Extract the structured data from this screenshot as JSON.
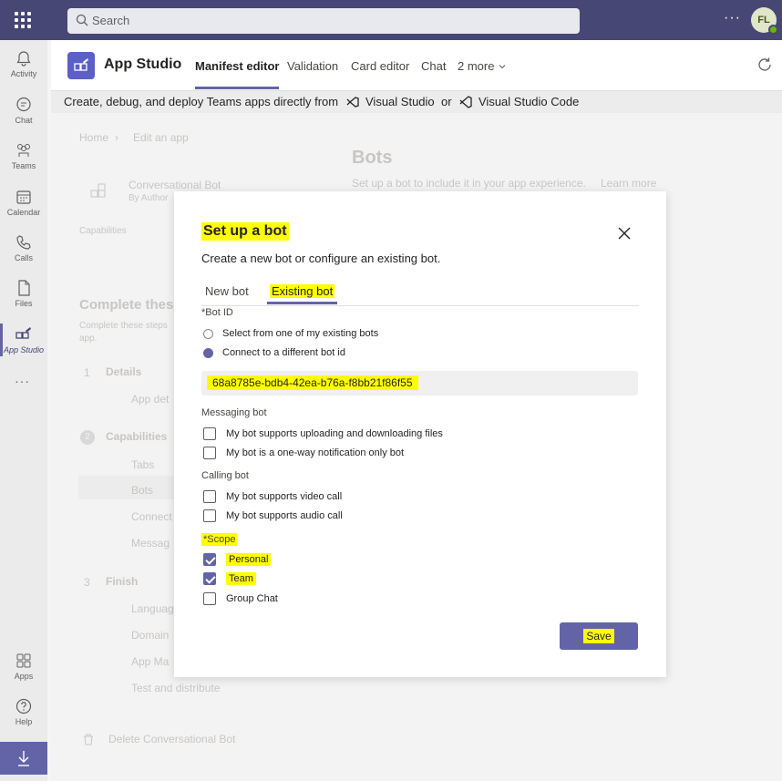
{
  "topbar": {
    "search_placeholder": "Search",
    "more": "···",
    "avatar_initials": "FL"
  },
  "rail": {
    "items": [
      {
        "label": "Activity",
        "icon": "bell-icon"
      },
      {
        "label": "Chat",
        "icon": "chat-icon"
      },
      {
        "label": "Teams",
        "icon": "teams-icon"
      },
      {
        "label": "Calendar",
        "icon": "calendar-icon"
      },
      {
        "label": "Calls",
        "icon": "phone-icon"
      },
      {
        "label": "Files",
        "icon": "file-icon"
      },
      {
        "label": "App Studio",
        "icon": "app-studio-icon"
      }
    ],
    "more": "···",
    "apps": "Apps",
    "help": "Help"
  },
  "app": {
    "title": "App Studio",
    "tabs": [
      "Manifest editor",
      "Validation",
      "Card editor",
      "Chat",
      "2 more"
    ],
    "active_tab": "Manifest editor"
  },
  "banner": {
    "text": "Create, debug, and deploy Teams apps directly from",
    "vs": "Visual Studio",
    "or": "or",
    "vscode": "Visual Studio Code"
  },
  "background": {
    "breadcrumb_home": "Home",
    "breadcrumb_current": "Edit an app",
    "app_name": "Conversational Bot",
    "app_author": "By Author",
    "capabilities": "Capabilities",
    "complete_heading": "Complete thes",
    "complete_sub_1": "Complete these steps",
    "complete_sub_2": "app.",
    "section1_num": "1",
    "section1": "Details",
    "section1_item": "App det",
    "section2_num": "2",
    "section2": "Capabilities",
    "section2_items": [
      "Tabs",
      "Bots",
      "Connect",
      "Messag"
    ],
    "section3_num": "3",
    "section3": "Finish",
    "section3_items": [
      "Languag",
      "Domain",
      "App Ma",
      "Test and distribute"
    ],
    "delete": "Delete Conversational Bot",
    "bots_heading": "Bots",
    "bots_desc": "Set up a bot to include it in your app experience.",
    "learn_more": "Learn more"
  },
  "dialog": {
    "title": "Set up a bot",
    "subtitle": "Create a new bot or configure an existing bot.",
    "tabs": [
      "New bot",
      "Existing bot"
    ],
    "bot_id_label": "*Bot ID",
    "radio_options": [
      {
        "label": "Select from one of my existing bots",
        "checked": false
      },
      {
        "label": "Connect to a different bot id",
        "checked": true
      }
    ],
    "bot_id_value": "68a8785e-bdb4-42ea-b76a-f8bb21f86f55",
    "messaging_label": "Messaging bot",
    "messaging_options": [
      {
        "label": "My bot supports uploading and downloading files",
        "checked": false
      },
      {
        "label": "My bot is a one-way notification only bot",
        "checked": false
      }
    ],
    "calling_label": "Calling bot",
    "calling_options": [
      {
        "label": "My bot supports video call",
        "checked": false
      },
      {
        "label": "My bot supports audio call",
        "checked": false
      }
    ],
    "scope_label": "*Scope",
    "scope_options": [
      {
        "label": "Personal",
        "checked": true
      },
      {
        "label": "Team",
        "checked": true
      },
      {
        "label": "Group Chat",
        "checked": false
      }
    ],
    "save": "Save",
    "highlight_color": "#ffff00",
    "accent_color": "#6264a7"
  }
}
